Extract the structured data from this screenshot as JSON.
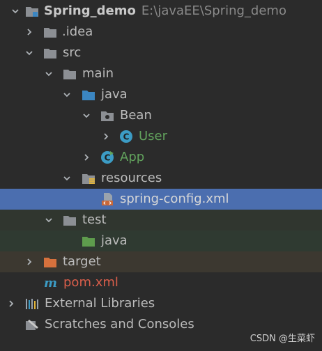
{
  "project": {
    "name": "Spring_demo",
    "path": "E:\\javaEE\\Spring_demo"
  },
  "tree": {
    "idea": ".idea",
    "src": "src",
    "main": "main",
    "java": "java",
    "bean_package": "Bean",
    "user_class": "User",
    "app_class": "App",
    "resources": "resources",
    "spring_config": "spring-config.xml",
    "test": "test",
    "test_java": "java",
    "target": "target",
    "pom": "pom.xml",
    "external_libraries": "External Libraries",
    "scratches": "Scratches and Consoles"
  },
  "watermark": "CSDN @生菜虾",
  "colors": {
    "background": "#2b2b2b",
    "selection": "#4b6eaf",
    "folder": "#8c8f94",
    "source_folder": "#3b86c2",
    "class_icon": "#3c9cc5",
    "green_text": "#62a35d",
    "target_folder": "#d6713d",
    "pom_text": "#d95e4b"
  },
  "icons": {
    "project": "project-folder-icon",
    "folder": "folder-icon",
    "source_folder": "source-folder-icon",
    "package": "package-icon",
    "class": "class-icon",
    "resources": "resources-folder-icon",
    "xml": "xml-file-icon",
    "maven": "maven-icon",
    "libraries": "libraries-icon",
    "scratches": "scratches-icon"
  }
}
